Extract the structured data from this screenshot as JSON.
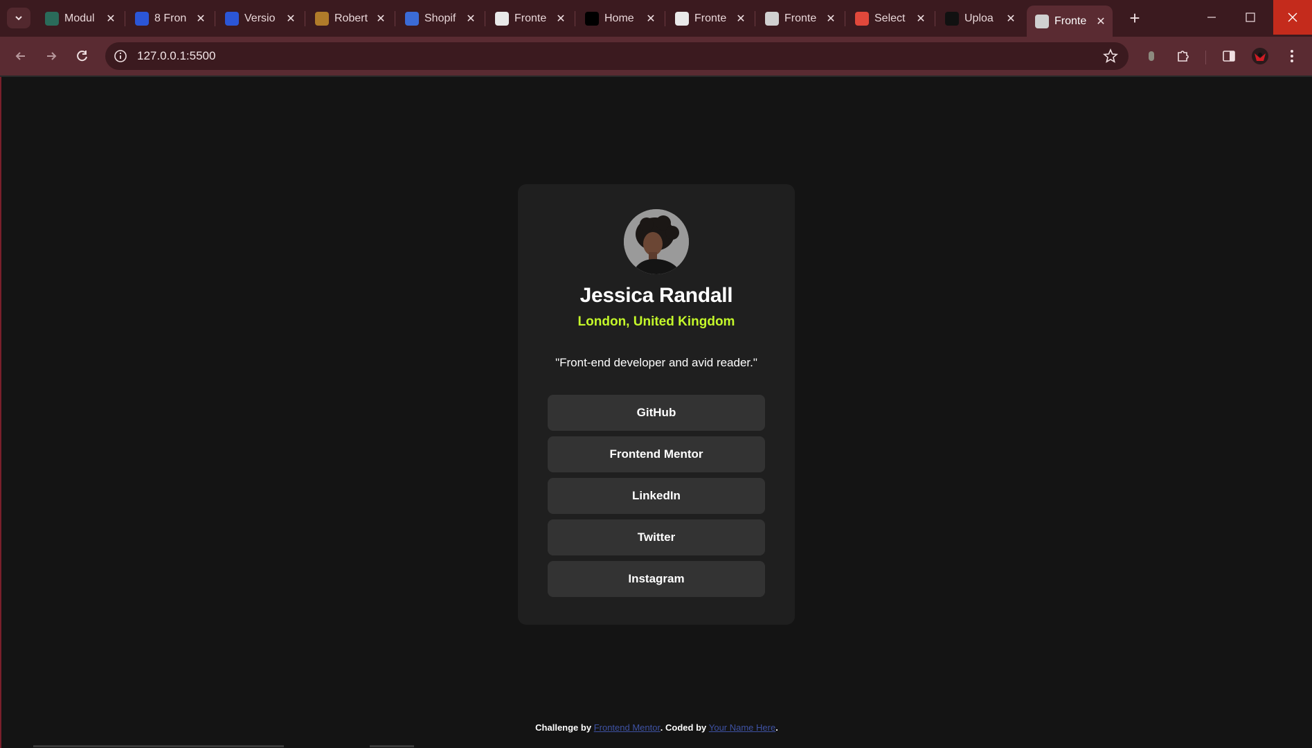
{
  "browser": {
    "tabs": [
      {
        "title": "Modul",
        "favicon": "openai-icon",
        "fav_color": "#2a6b5a"
      },
      {
        "title": "8 Fron",
        "favicon": "c-logo-icon",
        "fav_color": "#2b56d6"
      },
      {
        "title": "Versio",
        "favicon": "c-logo-icon",
        "fav_color": "#2b56d6"
      },
      {
        "title": "Robert",
        "favicon": "photo-icon",
        "fav_color": "#b07b2a"
      },
      {
        "title": "Shopif",
        "favicon": "flag-icon",
        "fav_color": "#3b6bd6"
      },
      {
        "title": "Fronte",
        "favicon": "doc-icon",
        "fav_color": "#e9e9e9"
      },
      {
        "title": "Home",
        "favicon": "x-logo-icon",
        "fav_color": "#000000"
      },
      {
        "title": "Fronte",
        "favicon": "doc-icon",
        "fav_color": "#e9e9e9"
      },
      {
        "title": "Fronte",
        "favicon": "globe-icon",
        "fav_color": "#d0d0d0"
      },
      {
        "title": "Select",
        "favicon": "colorful-icon",
        "fav_color": "#e0483b"
      },
      {
        "title": "Uploa",
        "favicon": "github-icon",
        "fav_color": "#111111"
      },
      {
        "title": "Fronte",
        "favicon": "globe-icon",
        "fav_color": "#d0d0d0",
        "active": true
      }
    ],
    "tab_close": "✕",
    "new_tab": "+",
    "url": "127.0.0.1:5500"
  },
  "profile": {
    "name": "Jessica Randall",
    "location": "London, United Kingdom",
    "bio": "\"Front-end developer and avid reader.\"",
    "links": [
      "GitHub",
      "Frontend Mentor",
      "LinkedIn",
      "Twitter",
      "Instagram"
    ]
  },
  "footer": {
    "prefix": "Challenge by ",
    "link1": "Frontend Mentor",
    "middle": ". Coded by ",
    "link2": "Your Name Here",
    "suffix": "."
  },
  "colors": {
    "page_bg": "#141414",
    "card_bg": "#1f1f1f",
    "accent": "#c4f82a",
    "button_bg": "#333333",
    "tabstrip_bg": "#3b1a1f",
    "toolbar_bg": "#5a2b32",
    "link": "#3e52a3"
  }
}
